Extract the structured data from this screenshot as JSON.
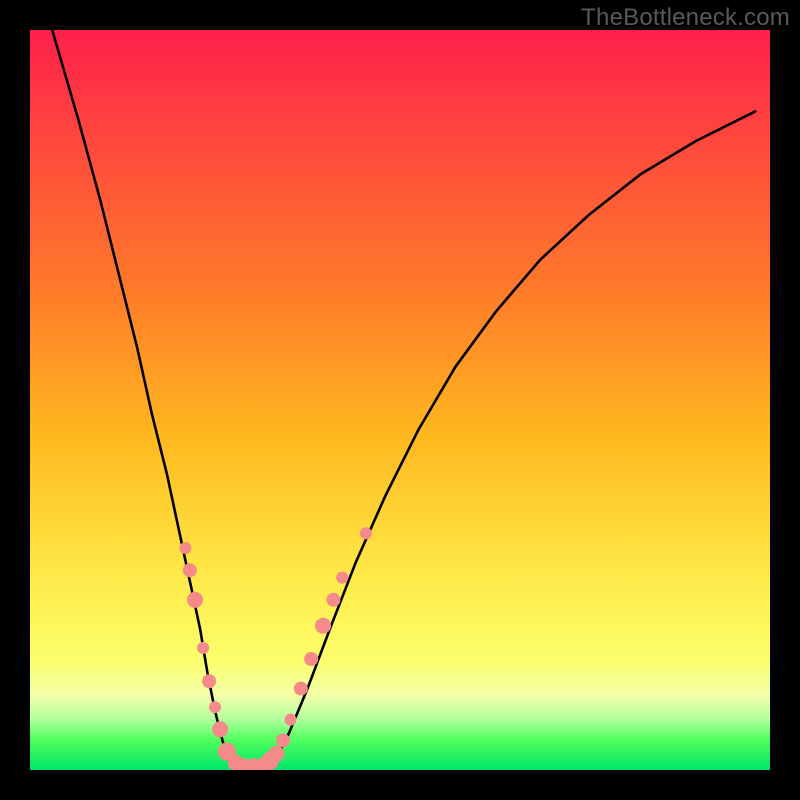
{
  "watermark": "TheBottleneck.com",
  "chart_data": {
    "type": "line",
    "title": "",
    "xlabel": "",
    "ylabel": "",
    "xlim": [
      0,
      100
    ],
    "ylim": [
      0,
      100
    ],
    "axes_visible": false,
    "grid": false,
    "background": {
      "kind": "vertical-gradient",
      "stops": [
        {
          "pos": 0.0,
          "color": "#ff1f4b"
        },
        {
          "pos": 0.12,
          "color": "#ff4040"
        },
        {
          "pos": 0.35,
          "color": "#ff7a2a"
        },
        {
          "pos": 0.55,
          "color": "#ffb81f"
        },
        {
          "pos": 0.72,
          "color": "#ffe544"
        },
        {
          "pos": 0.85,
          "color": "#fcff6a"
        },
        {
          "pos": 0.9,
          "color": "#f3ffa8"
        },
        {
          "pos": 0.93,
          "color": "#b5ff9f"
        },
        {
          "pos": 0.96,
          "color": "#4eff5e"
        },
        {
          "pos": 1.0,
          "color": "#00e56a"
        }
      ]
    },
    "series": [
      {
        "name": "curve-left",
        "stroke": "#000000",
        "x": [
          3.0,
          6.5,
          9.5,
          12.0,
          14.5,
          16.5,
          18.5,
          20.0,
          21.5,
          23.0,
          24.0,
          25.0,
          26.0,
          27.0
        ],
        "y": [
          100.0,
          88.0,
          77.0,
          67.0,
          57.0,
          48.0,
          40.0,
          33.0,
          26.0,
          19.0,
          13.0,
          8.0,
          4.0,
          1.0
        ]
      },
      {
        "name": "curve-floor",
        "stroke": "#000000",
        "x": [
          27.0,
          29.0,
          31.0,
          33.0
        ],
        "y": [
          1.0,
          0.5,
          0.5,
          1.0
        ]
      },
      {
        "name": "curve-right",
        "stroke": "#000000",
        "x": [
          33.0,
          35.0,
          37.5,
          40.5,
          44.0,
          48.0,
          52.5,
          57.5,
          63.0,
          69.0,
          75.5,
          82.5,
          90.0,
          98.0
        ],
        "y": [
          1.0,
          5.0,
          11.0,
          19.0,
          28.0,
          37.0,
          46.0,
          54.5,
          62.0,
          69.0,
          75.0,
          80.5,
          85.0,
          89.0
        ]
      }
    ],
    "markers": {
      "name": "highlight-dots",
      "fill": "#f58a8a",
      "r_range": [
        5,
        10
      ],
      "points": [
        {
          "x": 21.0,
          "y": 30.0,
          "r": 6
        },
        {
          "x": 21.6,
          "y": 27.0,
          "r": 7
        },
        {
          "x": 22.3,
          "y": 23.0,
          "r": 8
        },
        {
          "x": 23.4,
          "y": 16.5,
          "r": 6
        },
        {
          "x": 24.2,
          "y": 12.0,
          "r": 7
        },
        {
          "x": 25.0,
          "y": 8.5,
          "r": 6
        },
        {
          "x": 25.7,
          "y": 5.5,
          "r": 8
        },
        {
          "x": 26.6,
          "y": 2.5,
          "r": 9
        },
        {
          "x": 27.8,
          "y": 1.0,
          "r": 8
        },
        {
          "x": 29.0,
          "y": 0.6,
          "r": 7
        },
        {
          "x": 30.2,
          "y": 0.5,
          "r": 8
        },
        {
          "x": 31.4,
          "y": 0.7,
          "r": 7
        },
        {
          "x": 32.4,
          "y": 1.2,
          "r": 9
        },
        {
          "x": 33.3,
          "y": 2.2,
          "r": 8
        },
        {
          "x": 34.2,
          "y": 4.0,
          "r": 7
        },
        {
          "x": 35.2,
          "y": 6.8,
          "r": 6
        },
        {
          "x": 36.6,
          "y": 11.0,
          "r": 7
        },
        {
          "x": 38.0,
          "y": 15.0,
          "r": 7
        },
        {
          "x": 39.6,
          "y": 19.5,
          "r": 8
        },
        {
          "x": 41.0,
          "y": 23.0,
          "r": 7
        },
        {
          "x": 42.2,
          "y": 26.0,
          "r": 6
        },
        {
          "x": 45.4,
          "y": 32.0,
          "r": 6
        }
      ]
    }
  }
}
